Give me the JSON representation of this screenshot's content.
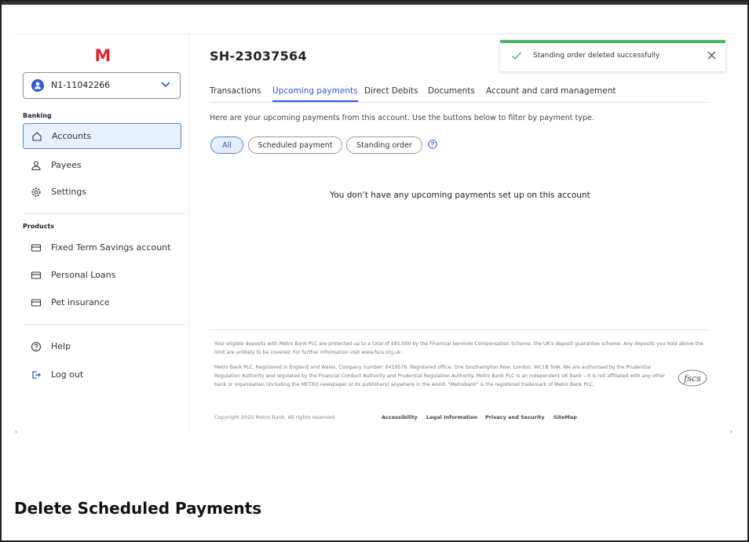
{
  "colors": {
    "accent": "#2f5bd3",
    "success": "#4db56b",
    "logo": "#e3262f"
  },
  "logo": {
    "letter": "M"
  },
  "sidebar": {
    "account_selector": {
      "value": "N1-11042266",
      "icon": "user-icon",
      "chevron": "chevron-down-icon"
    },
    "banking_label": "Banking",
    "banking_items": [
      {
        "label": "Accounts",
        "icon": "home-icon"
      },
      {
        "label": "Payees",
        "icon": "person-icon"
      },
      {
        "label": "Settings",
        "icon": "gear-icon"
      }
    ],
    "products_label": "Products",
    "product_items": [
      {
        "label": "Fixed Term Savings account",
        "icon": "card-icon"
      },
      {
        "label": "Personal Loans",
        "icon": "card-icon"
      },
      {
        "label": "Pet insurance",
        "icon": "card-icon"
      }
    ],
    "bottom_items": [
      {
        "label": "Help",
        "icon": "help-icon"
      },
      {
        "label": "Log out",
        "icon": "logout-icon"
      }
    ]
  },
  "main": {
    "account_title": "SH-23037564",
    "tabs": [
      "Transactions",
      "Upcoming payments",
      "Direct Debits",
      "Documents",
      "Account and card management"
    ],
    "active_tab": "Upcoming payments",
    "intro": "Here are your upcoming payments from this account. Use the buttons below to filter by payment type.",
    "filters": [
      "All",
      "Scheduled payment",
      "Standing order"
    ],
    "active_filter": "All",
    "empty_message": "You don’t have any upcoming payments set up on this account"
  },
  "toast": {
    "message": "Standing order deleted successfully",
    "close_icon": "close-icon",
    "status_icon": "check-icon"
  },
  "footer": {
    "para1": "Your eligible deposits with Metro Bank PLC are protected up to a total of £85,000 by the Financial Services Compensation Scheme, the UK's deposit guarantee scheme. Any deposits you hold above the limit are unlikely to be covered. For further information visit www.fscs.org.uk .",
    "para2": "Metro Bank PLC. Registered in England and Wales. Company number: 6419578. Registered office: One Southampton Row, London, WC1B 5HA. We are authorised by the Prudential Regulation Authority and regulated by the Financial Conduct Authority and Prudential Regulation Authority. Metro Bank PLC is an independent UK Bank – it is not affiliated with any other bank or organisation (including the METRO newspaper or its publishers) anywhere in the world. \"Metrobank\" is the registered trademark of Metro Bank PLC.",
    "copyright": "Copyright 2020 Metro Bank. All rights reserved.",
    "links": [
      "Accessibility",
      "Legal Information",
      "Privacy and Security",
      "SiteMap"
    ],
    "fscs_logo": "fscs"
  },
  "caption": "Delete Scheduled Payments"
}
